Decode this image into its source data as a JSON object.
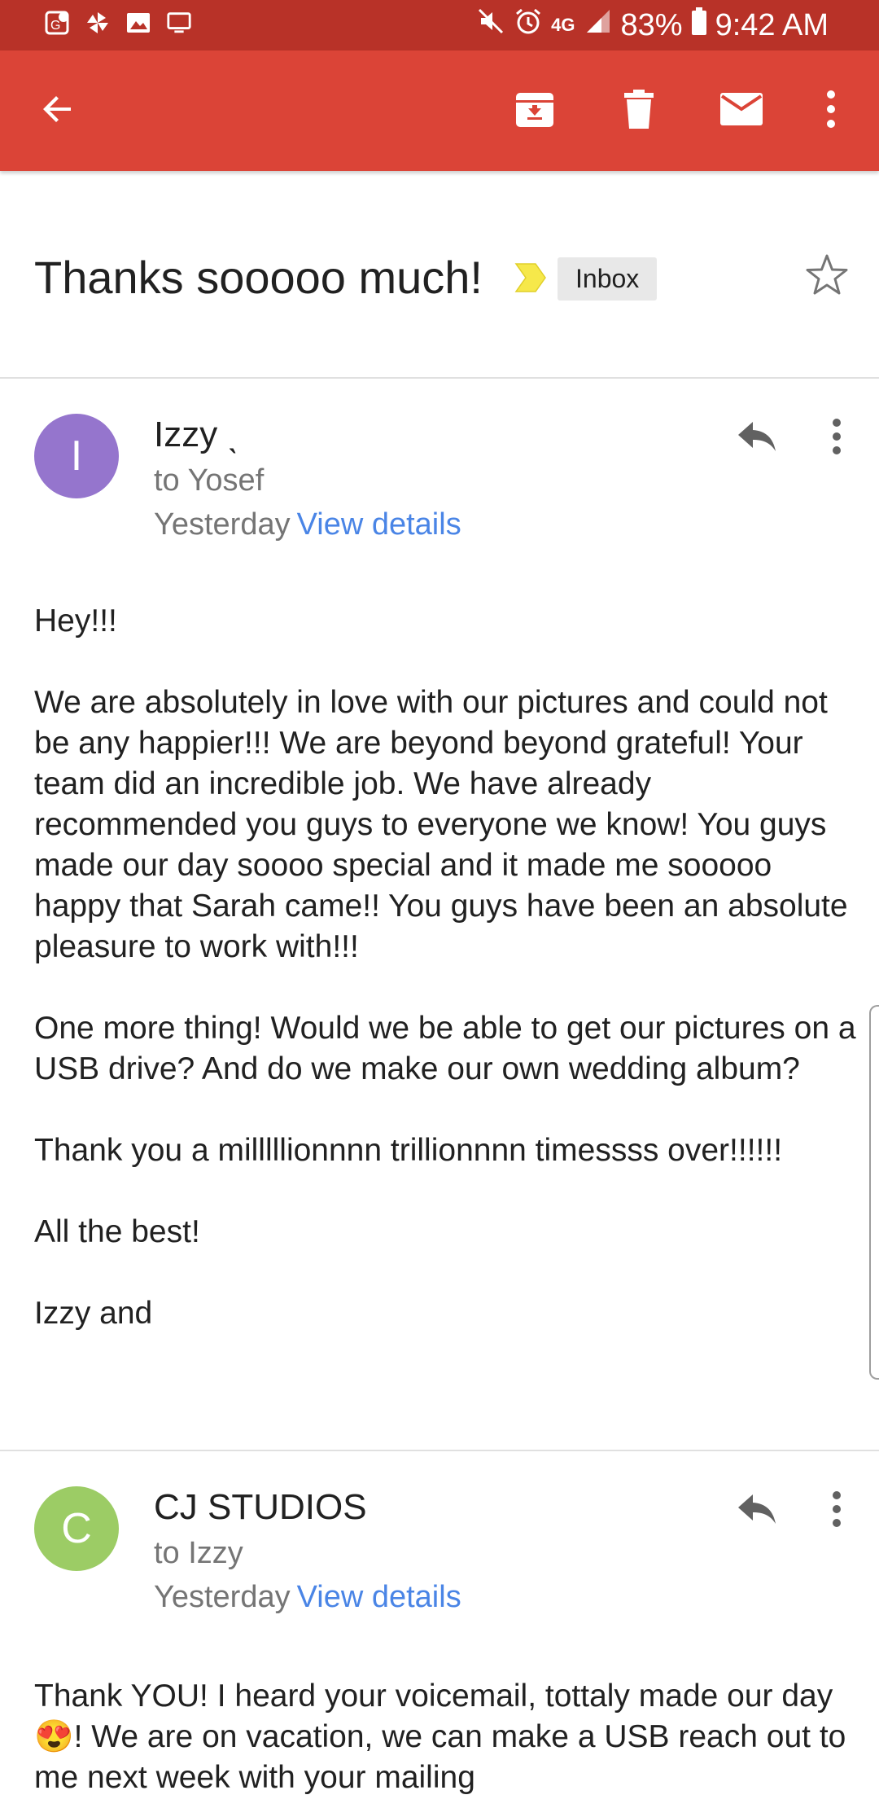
{
  "status_bar": {
    "battery": "83%",
    "time": "9:42 AM",
    "network": "4G",
    "left_icons": [
      "maps-icon",
      "pinwheel-icon",
      "image-icon",
      "monitor-icon"
    ],
    "right_icons": [
      "mute-icon",
      "alarm-icon",
      "signal-icon",
      "battery-icon"
    ]
  },
  "toolbar": {
    "icons": [
      "back-arrow-icon",
      "archive-icon",
      "delete-icon",
      "mark-unread-icon",
      "more-vert-icon"
    ],
    "color": "#db4437"
  },
  "thread": {
    "subject": "Thanks sooooo much!",
    "label": "Inbox",
    "important_color": "#f6e84a"
  },
  "messages": [
    {
      "avatar_letter": "I",
      "avatar_color": "#9575cd",
      "sender": "Izzy ˎ",
      "to": "to Yosef",
      "when": "Yesterday",
      "details_link": "View details",
      "body": [
        "Hey!!!",
        "We are absolutely in love with our pictures and could not be any happier!!! We are beyond beyond grateful! Your team did an incredible job. We have already recommended you guys to everyone we know! You guys made our day soooo special and it made me sooooo happy that Sarah came!! You guys have been an absolute pleasure to work with!!!",
        "One more thing! Would we be able to get our pictures on a USB drive? And do we make our own wedding album?",
        "Thank you a milllllionnnn trillionnnn timessss over!!!!!!",
        "All the best!",
        "Izzy and"
      ]
    },
    {
      "avatar_letter": "C",
      "avatar_color": "#9ccc65",
      "sender": "CJ STUDIOS",
      "to": "to Izzy",
      "when": "Yesterday",
      "details_link": "View details",
      "body_prefix": "Thank YOU! I heard your voicemail, tottaly made our day ",
      "body_emoji": "😍",
      "body_suffix": "! We are on vacation,  we can make a USB reach out to me next week with your mailing"
    }
  ]
}
